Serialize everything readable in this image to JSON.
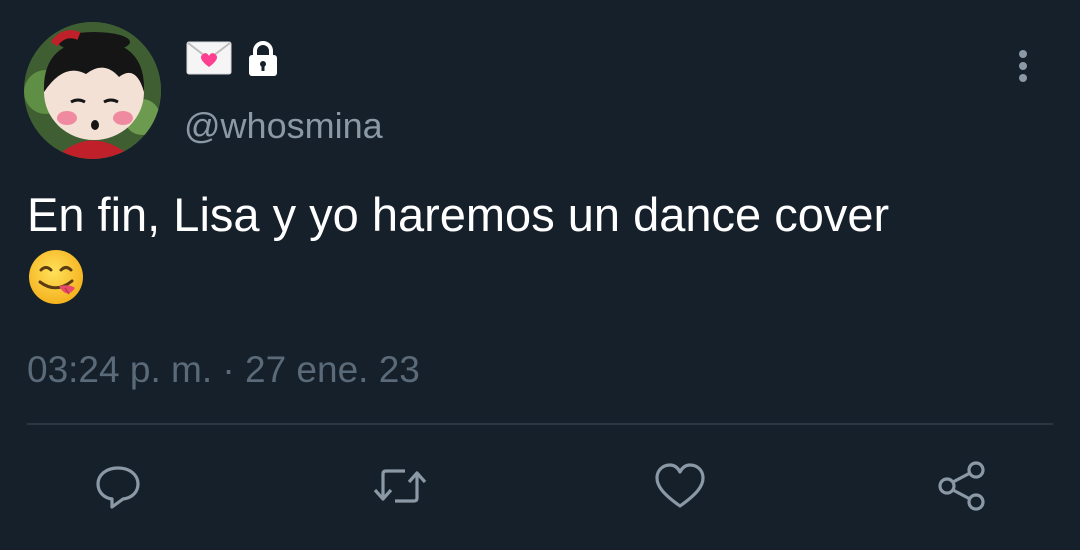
{
  "tweet": {
    "display_name_icons": [
      "love-letter-icon",
      "lock-icon"
    ],
    "handle": "@whosmina",
    "text": "En fin, Lisa y yo haremos un dance cover",
    "text_emoji": "face-savoring-food-emoji",
    "timestamp": "03:24 p. m. · 27 ene. 23"
  },
  "actions": [
    "reply-icon",
    "retweet-icon",
    "like-icon",
    "share-icon"
  ],
  "colors": {
    "background": "#15202b",
    "text": "#ffffff",
    "secondary": "#8b98a5",
    "icon": "#8b98a5",
    "divider": "#2b3844"
  }
}
